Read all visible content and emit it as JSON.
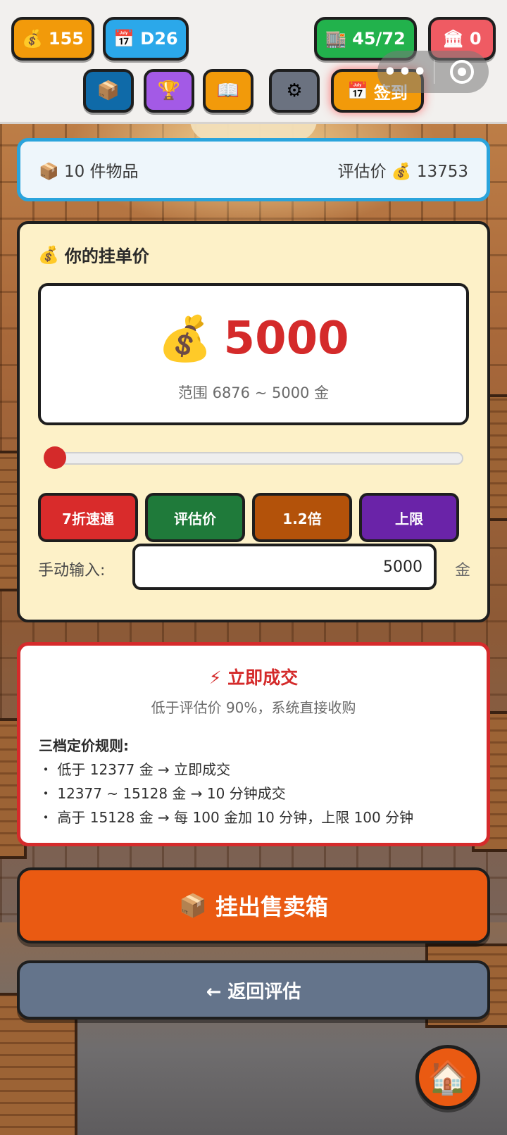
{
  "header": {
    "coins": "155",
    "day": "D26",
    "storage": "45/72",
    "bank": "0",
    "checkin": "签到"
  },
  "summary": {
    "items": "10 件物品",
    "estimate_label": "评估价",
    "estimate_value": "13753"
  },
  "price_card": {
    "title": "你的挂单价",
    "price": "5000",
    "range": "范围 6876 ~ 5000 金",
    "slider_fraction": 0.0,
    "quick_buttons": [
      "7折速通",
      "评估价",
      "1.2倍",
      "上限"
    ],
    "manual_label": "手动输入:",
    "manual_value": "5000",
    "manual_unit": "金"
  },
  "info": {
    "title": "立即成交",
    "subtitle": "低于评估价 90%，系统直接收购",
    "rules_title": "三档定价规则:",
    "rules": [
      "・ 低于 12377 金 → 立即成交",
      "・ 12377 ~ 15128 金 → 10 分钟成交",
      "・ 高于 15128 金 → 每 100 金加 10 分钟，上限 100 分钟"
    ]
  },
  "actions": {
    "list_button": "挂出售卖箱",
    "back_button": "← 返回评估"
  },
  "colors": {
    "coins": "#f29a0a",
    "day": "#2ba8ea",
    "storage": "#22b24c",
    "bank": "#ef5b63",
    "accent_red": "#d42a2a",
    "primary_orange": "#ea5a12",
    "back_gray": "#64748b",
    "btn_red": "#d92b2b",
    "btn_green": "#1f7a3a",
    "btn_brown": "#b3520a",
    "btn_purple": "#6a23a8"
  },
  "icons": [
    "money-bag-icon",
    "calendar-icon",
    "warehouse-icon",
    "bank-icon",
    "box-icon",
    "trophy-icon",
    "book-icon",
    "gear-icon",
    "lightning-icon",
    "home-icon",
    "more-dots-icon",
    "target-icon"
  ]
}
